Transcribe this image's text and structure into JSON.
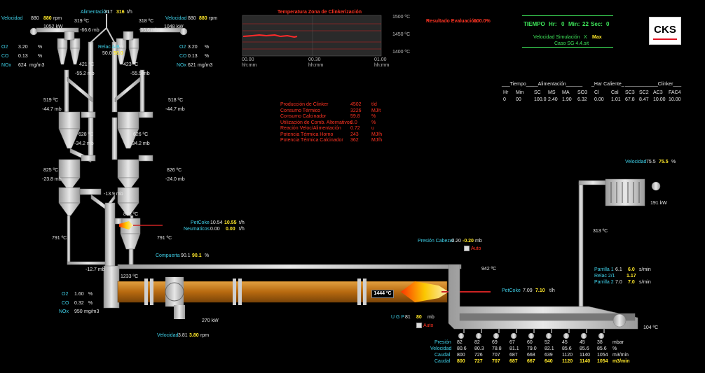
{
  "colors": {
    "cyan": "#3fd0e8",
    "yellow": "#ffe82a",
    "red": "#ff3322",
    "green": "#3ee55a",
    "kiln": "#c87818",
    "equipment": "#c8c8c8"
  },
  "left_string": {
    "velocidad_label": "Velocidad",
    "velocidad_value": "880",
    "velocidad_setpoint": "880",
    "velocidad_unit": "rpm",
    "power": "1052 kW",
    "o2_label": "O2",
    "o2_value": "3.20",
    "o2_unit": "%",
    "co_label": "CO",
    "co_value": "0.13",
    "co_unit": "%",
    "nox_label": "NOx",
    "nox_value": "624",
    "nox_unit": "mg/m3",
    "top_temp": "319 ºC",
    "top_press": "-66.6 mb",
    "c2_temp": "421 ºC",
    "c2_press": "-55.2 mb",
    "c3_temp": "519 ºC",
    "c3_press": "-44.7 mb",
    "c4_temp": "628 ºC",
    "c4_press": "-34.2 mb",
    "c5_temp": "825 ºC",
    "c5_press": "-23.8 mb",
    "riser_temp": "791 ºC",
    "riser_press": "-12.7 mb"
  },
  "right_string": {
    "velocidad_label": "Velocidad",
    "velocidad_value": "880",
    "velocidad_setpoint": "880",
    "velocidad_unit": "rpm",
    "power": "1048 kW",
    "o2_label": "O2",
    "o2_value": "3.20",
    "o2_unit": "%",
    "co_label": "CO",
    "co_value": "0.13",
    "co_unit": "%",
    "nox_label": "NOx",
    "nox_value": "621",
    "nox_unit": "mg/m3",
    "top_temp": "318 ºC",
    "top_press": "-66.6 mb",
    "c2_temp": "423 ºC",
    "c2_press": "-55.5 mb",
    "c3_temp": "518 ºC",
    "c3_press": "-44.7 mb",
    "c4_temp": "626 ºC",
    "c4_press": "-34.2 mb",
    "c5_temp": "826 ºC",
    "c5_press": "-24.0 mb",
    "riser_temp": "791 ºC"
  },
  "feed": {
    "label": "Alimentación",
    "value": "317",
    "setpoint": "316",
    "unit": "t/h",
    "relac_label": "Relac A/B",
    "relac_unit": "%",
    "relac_value": "50.0",
    "relac_setpoint": "50.0"
  },
  "calciner": {
    "temp": "878 ºC",
    "press": "-13.9 mb",
    "petcoke_label": "PetCoke",
    "petcoke_value": "10.54",
    "petcoke_setpoint": "10.55",
    "petcoke_unit": "t/h",
    "neumaticos_label": "Neumaticos",
    "neumaticos_value": "0.00",
    "neumaticos_setpoint": "0.00",
    "neumaticos_unit": "t/h",
    "compuerta_label": "Compuerta",
    "compuerta_value": "90.1",
    "compuerta_setpoint": "90.1",
    "compuerta_unit": "%"
  },
  "kiln_inlet": {
    "temp": "1233 ºC",
    "o2_label": "O2",
    "o2_value": "1.60",
    "o2_unit": "%",
    "co_label": "CO",
    "co_value": "0.32",
    "co_unit": "%",
    "nox_label": "NOx",
    "nox_value": "950",
    "nox_unit": "mg/m3"
  },
  "kiln": {
    "drive_power": "270 kW",
    "velocidad_label": "Velocidad",
    "velocidad_value": "3.81",
    "velocidad_setpoint": "3.80",
    "velocidad_unit": "rpm",
    "burning_temp": "1444 ºC",
    "petcoke_label": "PetCoke",
    "petcoke_value": "7.09",
    "petcoke_setpoint": "7.10",
    "petcoke_unit": "t/h"
  },
  "hood": {
    "presion_label": "Presión Cabezal",
    "presion_value": "-0.20",
    "presion_setpoint": "-0.20",
    "presion_unit": "mb",
    "auto_label": "Auto",
    "temp": "942 ºC"
  },
  "ugp": {
    "label": "U G P",
    "value": "81",
    "setpoint": "80",
    "unit": "mb",
    "auto_label": "Auto"
  },
  "cooler": {
    "exhaust_temp": "313 ºC",
    "fan_power": "191 kW",
    "outlet_temp": "104 ºC",
    "fan_velocidad_label": "Velocidad",
    "fan_velocidad_value": "75.5",
    "fan_velocidad_setpoint": "75.5",
    "fan_velocidad_unit": "%",
    "parrilla1_label": "Parrilla 1",
    "parrilla1_value": "6.1",
    "parrilla1_setpoint": "6.0",
    "parrilla_unit": "s/min",
    "relac_label": "Relac 2/1",
    "relac_value": "1.17",
    "parrilla2_label": "Parrilla 2",
    "parrilla2_value": "7.0",
    "parrilla2_setpoint": "7.0"
  },
  "fans_table": {
    "rows": [
      {
        "label": "Presión",
        "unit": "mbar",
        "values": [
          "82",
          "82",
          "69",
          "67",
          "60",
          "52",
          "45",
          "45",
          "38"
        ],
        "cls": "wh"
      },
      {
        "label": "Velocidad",
        "unit": "%",
        "values": [
          "80.6",
          "80.3",
          "78.8",
          "81.1",
          "79.0",
          "82.1",
          "85.6",
          "85.6",
          "85.6"
        ],
        "cls": "wh"
      },
      {
        "label": "Caudal",
        "unit": "m3/min",
        "values": [
          "800",
          "726",
          "707",
          "687",
          "668",
          "639",
          "1120",
          "1140",
          "1054"
        ],
        "cls": "wh"
      },
      {
        "label": "Caudal",
        "unit": "m3/min",
        "values": [
          "800",
          "727",
          "707",
          "687",
          "667",
          "640",
          "1120",
          "1140",
          "1054"
        ],
        "cls": "yl"
      }
    ]
  },
  "temp_chart": {
    "title": "Temperatura Zona de Clinkerización",
    "y_ticks": [
      "1500 ºC",
      "1450 ºC",
      "1400 ºC"
    ],
    "x_ticks": [
      "00.00",
      "00.30",
      "01.00"
    ],
    "x_unit": "hh:mm"
  },
  "resultado": {
    "label": "Resultado Evaluación",
    "value": "100.0%"
  },
  "production": {
    "rows": [
      {
        "label": "Producción de Clinker",
        "value": "4502",
        "unit": "t/d"
      },
      {
        "label": "Consumo Térmico",
        "value": "3226",
        "unit": "MJ/t"
      },
      {
        "label": "Consumo Calcinador",
        "value": "59.8",
        "unit": "%"
      },
      {
        "label": "Utilización de Comb. Alternativos",
        "value": "0.0",
        "unit": "%"
      },
      {
        "label": "Reación Veloc/Alimentación",
        "value": "0.72",
        "unit": "u"
      },
      {
        "label": "Potencia Térmica Horno",
        "value": "243",
        "unit": "MJ/h"
      },
      {
        "label": "Potencia Térmica Calcinador",
        "value": "362",
        "unit": "MJ/h"
      }
    ]
  },
  "sim": {
    "tiempo_label": "TIEMPO",
    "hr_label": "Hr:",
    "hr": "0",
    "min_label": "Min:",
    "min": "22",
    "sec_label": "Sec:",
    "sec": "0",
    "vel_label": "Velocidad Simulación",
    "vel_x": "X",
    "vel_value": "Max",
    "case": "Caso SG 4.4.sit"
  },
  "logo": "CKS",
  "lab_table": {
    "groups": [
      "___Tiempo___",
      "___Alimentación______",
      "_Har Caliente_",
      "____________Clinker___"
    ],
    "headers": [
      "Hr",
      "Min",
      "SC",
      "MS",
      "MA",
      "SO3",
      "Cl",
      "Cal",
      "SC3",
      "SC2",
      "AC3",
      "FAC4"
    ],
    "values": [
      "0",
      "00",
      "100.0",
      "2.40",
      "1.90",
      "6.32",
      "0.00",
      "1.01",
      "67.8",
      "8.47",
      "10.00",
      "10.00"
    ]
  }
}
